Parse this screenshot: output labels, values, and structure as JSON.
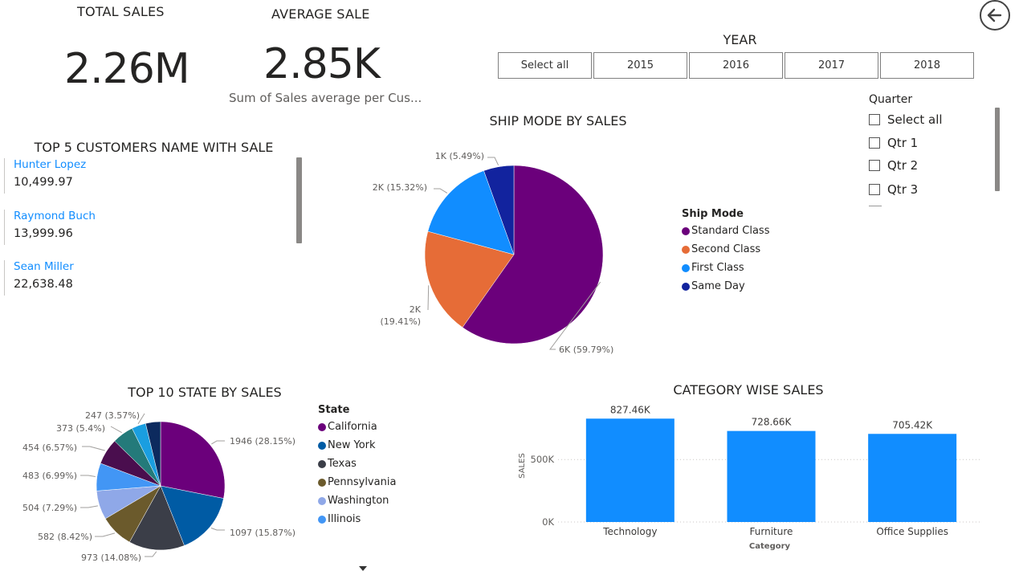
{
  "kpis": {
    "total_sales": {
      "title": "TOTAL SALES",
      "value": "2.26M"
    },
    "average_sale": {
      "title": "AVERAGE SALE",
      "value": "2.85K",
      "subtitle": "Sum of Sales average per Cus..."
    }
  },
  "year_slicer": {
    "title": "YEAR",
    "options": [
      "Select all",
      "2015",
      "2016",
      "2017",
      "2018"
    ]
  },
  "quarter_slicer": {
    "title": "Quarter",
    "options": [
      "Select all",
      "Qtr 1",
      "Qtr 2",
      "Qtr 3"
    ]
  },
  "top_customers": {
    "title": "TOP 5 CUSTOMERS NAME WITH SALE",
    "items": [
      {
        "name": "Hunter Lopez",
        "value": "10,499.97"
      },
      {
        "name": "Raymond Buch",
        "value": "13,999.96"
      },
      {
        "name": "Sean Miller",
        "value": "22,638.48"
      }
    ]
  },
  "ship_mode": {
    "title": "SHIP MODE BY SALES",
    "legend_title": "Ship Mode"
  },
  "top_states": {
    "title": "TOP 10 STATE BY SALES",
    "legend_title": "State"
  },
  "category": {
    "title": "CATEGORY WISE SALES"
  },
  "icons": {
    "back": "back-arrow-icon",
    "dropdown": "caret-down-icon"
  },
  "colors": {
    "accent": "#118dff",
    "text": "#252423"
  },
  "chart_data": [
    {
      "type": "pie",
      "id": "ship_mode",
      "title": "SHIP MODE BY SALES",
      "legend": "right",
      "slices": [
        {
          "name": "Standard Class",
          "value": 6,
          "label": "6K (59.79%)",
          "color": "#6b007b"
        },
        {
          "name": "Second Class",
          "value": 2,
          "label": "2K (19.41%)",
          "color": "#e66c37"
        },
        {
          "name": "First Class",
          "value": 2,
          "label": "2K (15.32%)",
          "color": "#118dff"
        },
        {
          "name": "Same Day",
          "value": 1,
          "label": "1K (5.49%)",
          "color": "#12239e"
        }
      ],
      "percents": [
        59.79,
        19.41,
        15.32,
        5.49
      ]
    },
    {
      "type": "pie",
      "id": "top_states",
      "title": "TOP 10 STATE BY SALES",
      "legend": "right",
      "slices": [
        {
          "name": "California",
          "value": 1946,
          "label": "1946 (28.15%)",
          "color": "#6b007b"
        },
        {
          "name": "New York",
          "value": 1097,
          "label": "1097 (15.87%)",
          "color": "#005ba4"
        },
        {
          "name": "Texas",
          "value": 973,
          "label": "973 (14.08%)",
          "color": "#3b3e48"
        },
        {
          "name": "Pennsylvania",
          "value": 582,
          "label": "582 (8.42%)",
          "color": "#6b5a2c"
        },
        {
          "name": "Washington",
          "value": 504,
          "label": "504 (7.29%)",
          "color": "#8fa8e8"
        },
        {
          "name": "Illinois",
          "value": 483,
          "label": "483 (6.99%)",
          "color": "#4296f5"
        },
        {
          "name": "",
          "value": 454,
          "label": "454 (6.57%)",
          "color": "#4a0e4e"
        },
        {
          "name": "",
          "value": 373,
          "label": "373 (5.4%)",
          "color": "#247a7a"
        },
        {
          "name": "",
          "value": 247,
          "label": "247 (3.57%)",
          "color": "#1a9ee0"
        },
        {
          "name": "",
          "value": 0,
          "label": "",
          "color": "#0c2a5e"
        }
      ],
      "legend_visible": [
        "California",
        "New York",
        "Texas",
        "Pennsylvania",
        "Washington",
        "Illinois"
      ]
    },
    {
      "type": "bar",
      "id": "category",
      "title": "CATEGORY WISE SALES",
      "categories": [
        "Technology",
        "Furniture",
        "Office Supplies"
      ],
      "values": [
        827.46,
        728.66,
        705.42
      ],
      "value_labels": [
        "827.46K",
        "728.66K",
        "705.42K"
      ],
      "xlabel": "Category",
      "ylabel": "SALES",
      "yticks": [
        "0K",
        "500K"
      ],
      "ylim": [
        0,
        900
      ],
      "unit": "K",
      "color": "#118dff",
      "grid": true
    }
  ]
}
